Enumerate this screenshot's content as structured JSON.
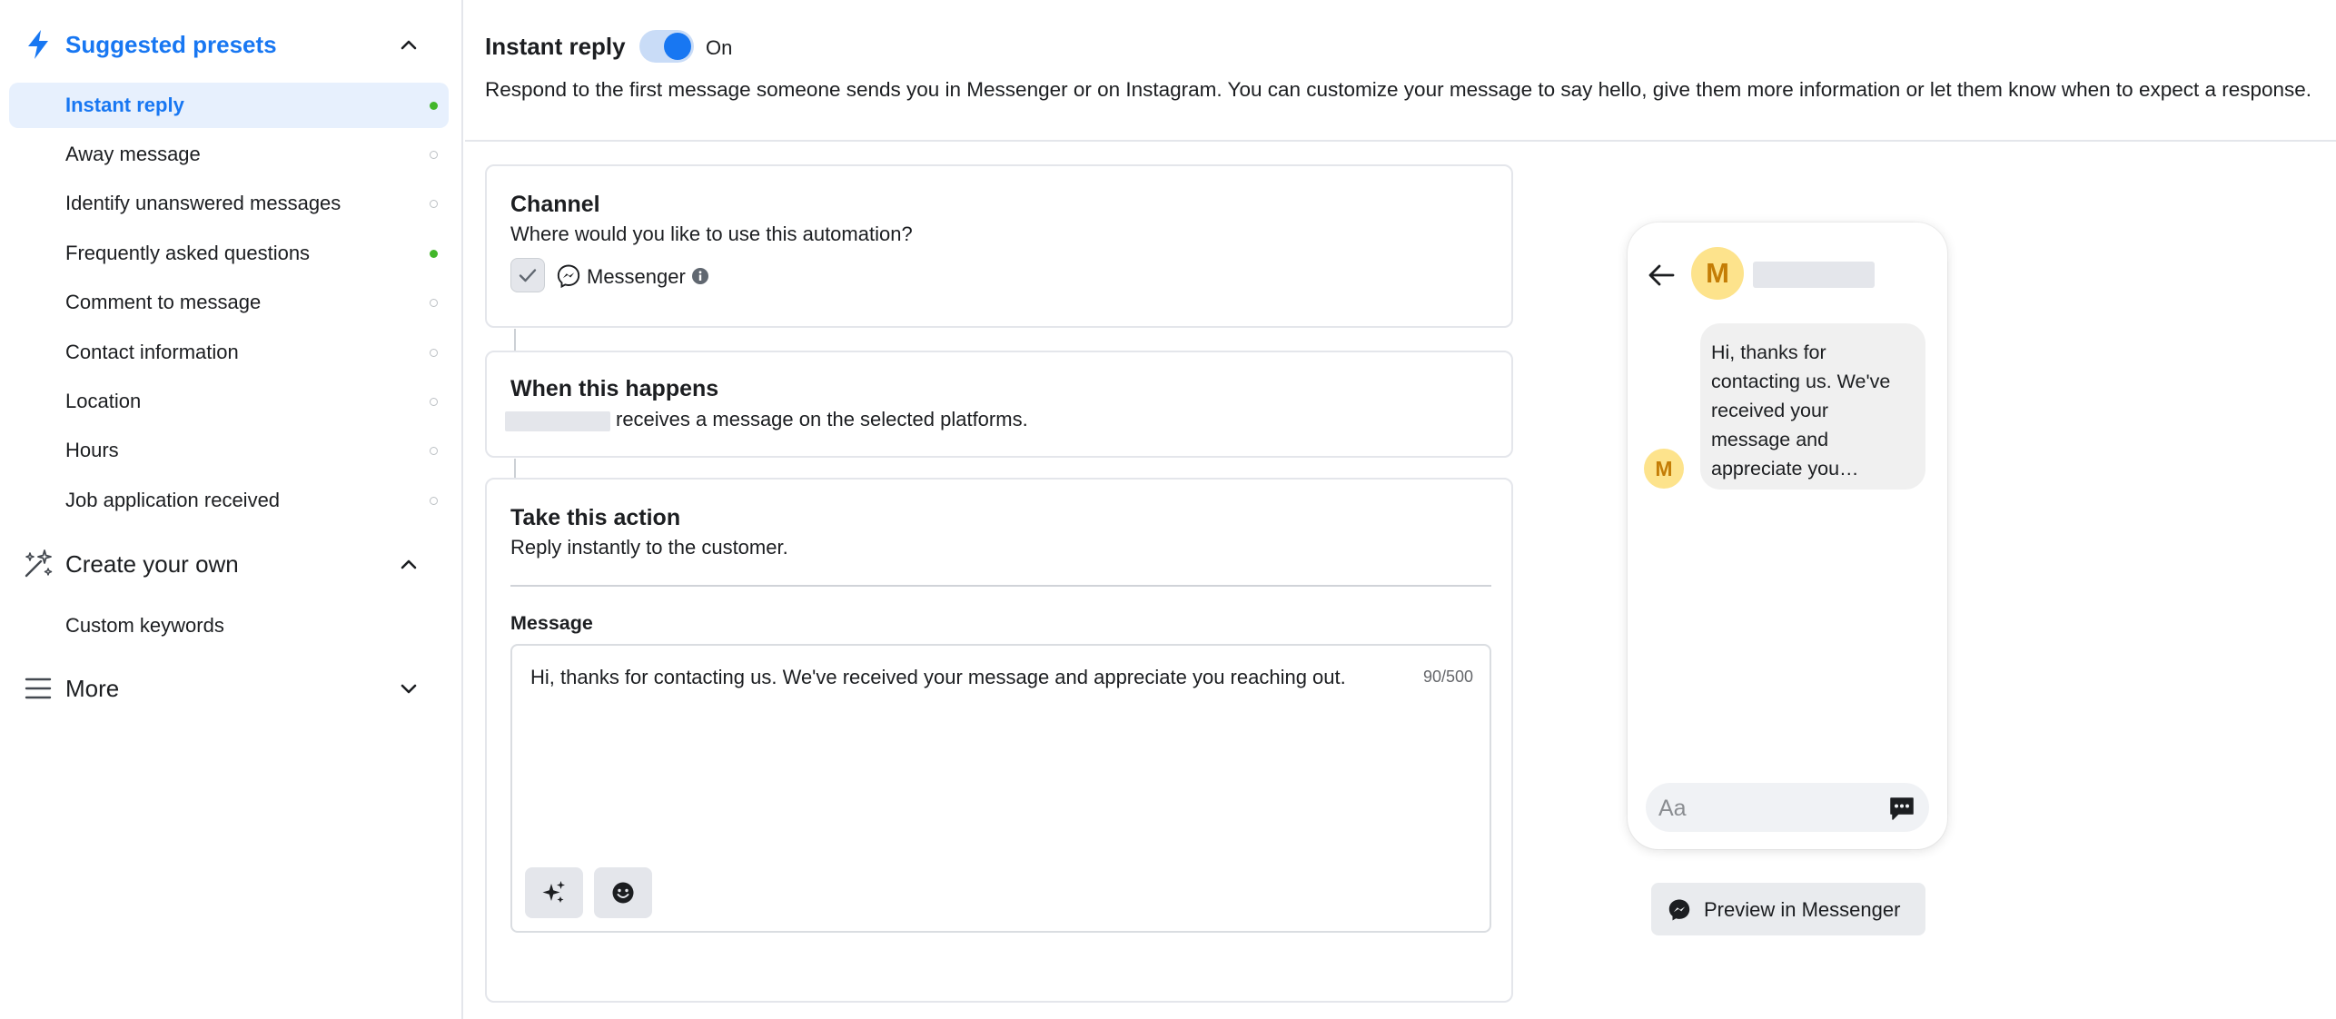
{
  "sidebar": {
    "suggested": {
      "label": "Suggested presets",
      "icon": "lightning-icon"
    },
    "items": [
      {
        "label": "Instant reply",
        "active": true,
        "status": "green"
      },
      {
        "label": "Away message",
        "status": "empty"
      },
      {
        "label": "Identify unanswered messages",
        "status": "empty"
      },
      {
        "label": "Frequently asked questions",
        "status": "green"
      },
      {
        "label": "Comment to message",
        "status": "empty"
      },
      {
        "label": "Contact information",
        "status": "empty"
      },
      {
        "label": "Location",
        "status": "empty"
      },
      {
        "label": "Hours",
        "status": "empty"
      },
      {
        "label": "Job application received",
        "status": "empty"
      }
    ],
    "create": {
      "label": "Create your own",
      "icon": "sparkle-wand-icon"
    },
    "create_items": [
      {
        "label": "Custom keywords"
      }
    ],
    "more": {
      "label": "More",
      "icon": "menu-lines-icon"
    }
  },
  "header": {
    "title": "Instant reply",
    "toggle_state": "On",
    "description": "Respond to the first message someone sends you in Messenger or on Instagram. You can customize your message to say hello, give them more information or let them know when to expect a response."
  },
  "channel": {
    "title": "Channel",
    "subtitle": "Where would you like to use this automation?",
    "option_label": "Messenger",
    "checked": true
  },
  "trigger": {
    "title": "When this happens",
    "subtitle": "receives a message on the selected platforms."
  },
  "action": {
    "title": "Take this action",
    "subtitle": "Reply instantly to the customer.",
    "message_label": "Message",
    "message_text": "Hi, thanks for contacting us. We've received your message and appreciate you reaching out.",
    "char_count": "90/500"
  },
  "preview": {
    "avatar_letter": "M",
    "bubble_text": "Hi, thanks for contacting us. We've received your message and appreciate you…",
    "compose_placeholder": "Aa",
    "button_label": "Preview in Messenger"
  },
  "colors": {
    "accent": "#1877f2",
    "active_bg": "#e7f0fd",
    "status_green": "#42b72a",
    "avatar_bg": "#fde38c",
    "avatar_fg": "#c47d06"
  }
}
